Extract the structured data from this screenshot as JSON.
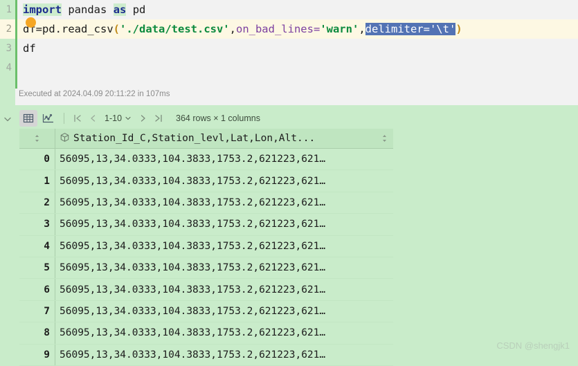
{
  "editor": {
    "line_numbers": [
      "1",
      "2",
      "3",
      "4"
    ],
    "code": {
      "line1": {
        "kw_import": "import",
        "sp1": " ",
        "mod": "pandas",
        "sp2": " ",
        "kw_as": "as",
        "sp3": " ",
        "alias": "pd"
      },
      "line2": {
        "head": "df=pd.read_csv",
        "lparen": "(",
        "path": "'./data/test.csv'",
        "comma1": ",",
        "param1": "on_bad_lines=",
        "val1": "'warn'",
        "comma2": ",",
        "selected": "delimiter='\\t'",
        "rparen": ")"
      },
      "line3": "df",
      "line4": ""
    },
    "cursor_icon": "text-cursor-dot",
    "execution_status": "Executed at 2024.04.09 20:11:22 in 107ms"
  },
  "output": {
    "collapse_icon": "chevron-down-icon",
    "toolbar": {
      "table_view_icon": "table-grid-icon",
      "chart_view_icon": "line-chart-icon",
      "first_page_icon": "first-page-icon",
      "prev_page_icon": "chevron-left-icon",
      "page_range": "1-10",
      "page_dropdown_icon": "chevron-down-icon",
      "next_page_icon": "chevron-right-icon",
      "last_page_icon": "last-page-icon",
      "rows_info": "364 rows × 1 columns"
    },
    "table": {
      "index_sort_icon": "sort-updown-icon",
      "column_type_icon": "cube-icon",
      "column_header": "Station_Id_C,Station_levl,Lat,Lon,Alt...",
      "column_sort_icon": "sort-updown-icon",
      "rows": [
        {
          "index": "0",
          "value": "56095,13,34.0333,104.3833,1753.2,621223,621…"
        },
        {
          "index": "1",
          "value": "56095,13,34.0333,104.3833,1753.2,621223,621…"
        },
        {
          "index": "2",
          "value": "56095,13,34.0333,104.3833,1753.2,621223,621…"
        },
        {
          "index": "3",
          "value": "56095,13,34.0333,104.3833,1753.2,621223,621…"
        },
        {
          "index": "4",
          "value": "56095,13,34.0333,104.3833,1753.2,621223,621…"
        },
        {
          "index": "5",
          "value": "56095,13,34.0333,104.3833,1753.2,621223,621…"
        },
        {
          "index": "6",
          "value": "56095,13,34.0333,104.3833,1753.2,621223,621…"
        },
        {
          "index": "7",
          "value": "56095,13,34.0333,104.3833,1753.2,621223,621…"
        },
        {
          "index": "8",
          "value": "56095,13,34.0333,104.3833,1753.2,621223,621…"
        },
        {
          "index": "9",
          "value": "56095,13,34.0333,104.3833,1753.2,621223,621…"
        }
      ]
    }
  },
  "watermark": "CSDN @shengjk1",
  "colors": {
    "background": "#c9ecca",
    "editor_bg": "#f2f2f2",
    "current_line": "#fdf8e3",
    "gutter_accent": "#6bbf6b",
    "selection": "#5373b4",
    "keyword": "#1d2c8f",
    "string": "#0c8a3e",
    "param": "#7b3fa0",
    "paren": "#c08a1a",
    "cursor_dot": "#f5a623"
  }
}
